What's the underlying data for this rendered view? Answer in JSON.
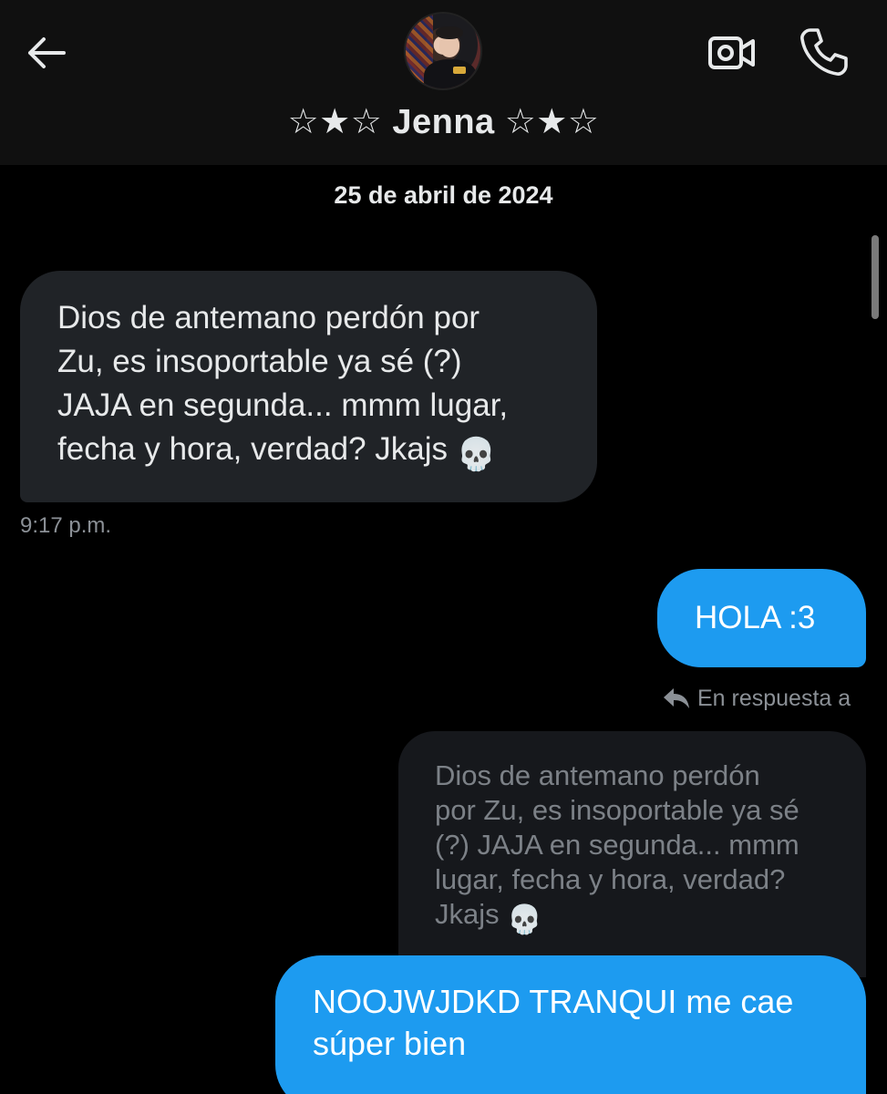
{
  "header": {
    "contact_name": "☆★☆ Jenna ☆★☆",
    "icons": {
      "back": "arrow-left-icon",
      "video": "video-camera-icon",
      "call": "phone-icon"
    }
  },
  "conversation": {
    "date_separator": "25 de abril de 2024",
    "messages": [
      {
        "direction": "incoming",
        "text": "Dios de antemano perdón por\nZu, es insoportable ya sé (?)\nJAJA en segunda... mmm lugar,\nfecha y hora, verdad? Jkajs",
        "emoji": "💀",
        "time": "9:17 p.m."
      },
      {
        "direction": "outgoing",
        "text": "HOLA :3"
      },
      {
        "direction": "outgoing",
        "reply_label": "En respuesta a",
        "quoted_text": "Dios de antemano perdón\npor Zu, es insoportable ya sé\n(?) JAJA en segunda... mmm\nlugar, fecha y hora, verdad?\nJkajs",
        "quoted_emoji": "💀",
        "text": "NOOJWJDKD TRANQUI me cae\nsúper bien"
      }
    ]
  },
  "colors": {
    "background": "#000000",
    "header_bg": "#101010",
    "incoming_bubble": "#202327",
    "outgoing_bubble": "#1d9bf0",
    "quoted_bubble": "#16181c",
    "muted_text": "#8b9096"
  }
}
